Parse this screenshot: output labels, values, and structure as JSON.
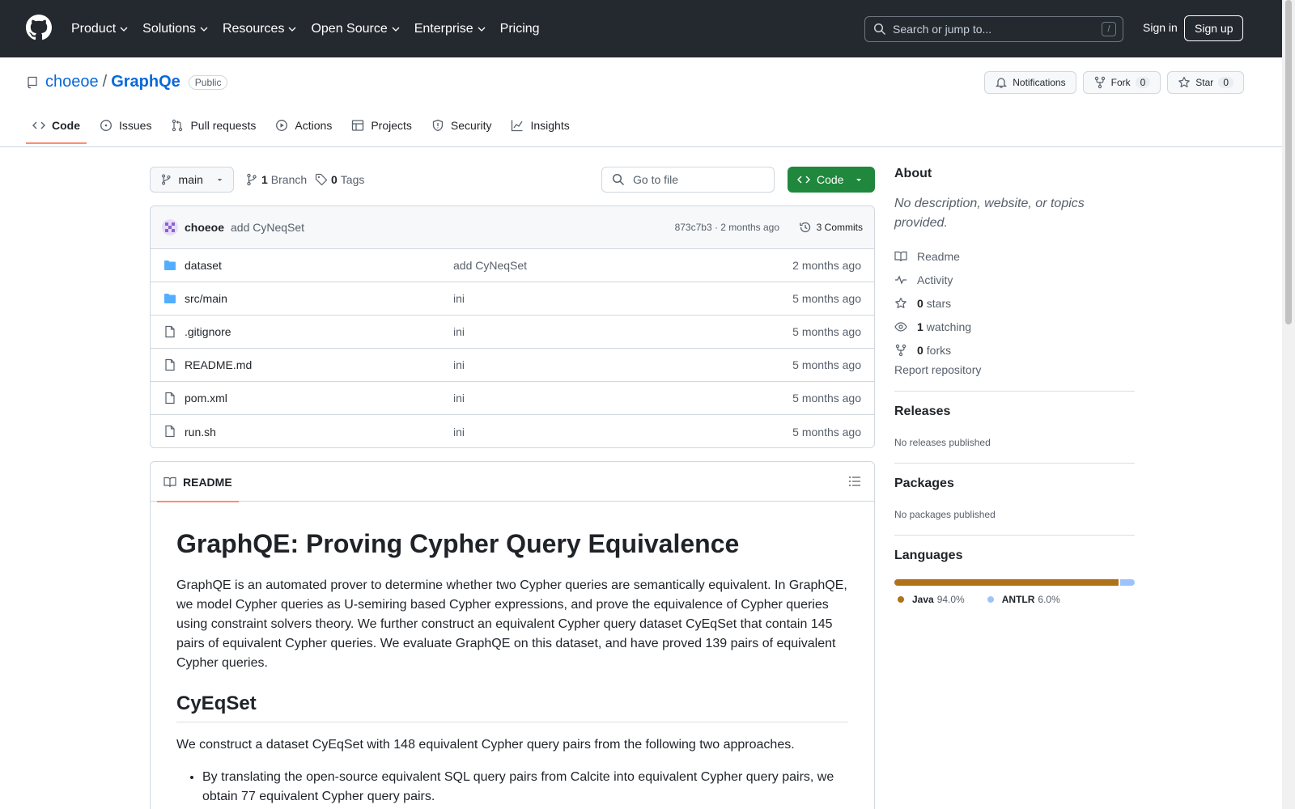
{
  "header": {
    "nav": [
      "Product",
      "Solutions",
      "Resources",
      "Open Source",
      "Enterprise",
      "Pricing"
    ],
    "search_placeholder": "Search or jump to...",
    "search_shortcut": "/",
    "signin": "Sign in",
    "signup": "Sign up"
  },
  "repo": {
    "owner": "choeoe",
    "separator": "/",
    "name": "GraphQe",
    "visibility": "Public",
    "notifications_label": "Notifications",
    "fork_label": "Fork",
    "fork_count": "0",
    "star_label": "Star",
    "star_count": "0",
    "tabs": [
      "Code",
      "Issues",
      "Pull requests",
      "Actions",
      "Projects",
      "Security",
      "Insights"
    ]
  },
  "branchbar": {
    "branch": "main",
    "branch_count": "1",
    "branch_label": "Branch",
    "tag_count": "0",
    "tag_label": "Tags",
    "goto_placeholder": "Go to file",
    "code_label": "Code"
  },
  "commit": {
    "author": "choeoe",
    "message": "add CyNeqSet",
    "meta": "873c7b3 · 2 months ago",
    "count_label": "3 Commits"
  },
  "files": [
    {
      "type": "folder",
      "name": "dataset",
      "message": "add CyNeqSet",
      "time": "2 months ago"
    },
    {
      "type": "folder",
      "name": "src/main",
      "message": "ini",
      "time": "5 months ago"
    },
    {
      "type": "file",
      "name": ".gitignore",
      "message": "ini",
      "time": "5 months ago"
    },
    {
      "type": "file",
      "name": "README.md",
      "message": "ini",
      "time": "5 months ago"
    },
    {
      "type": "file",
      "name": "pom.xml",
      "message": "ini",
      "time": "5 months ago"
    },
    {
      "type": "file",
      "name": "run.sh",
      "message": "ini",
      "time": "5 months ago"
    }
  ],
  "readme": {
    "tab_label": "README",
    "h1": "GraphQE: Proving Cypher Query Equivalence",
    "p1": "GraphQE is an automated prover to determine whether two Cypher queries are semantically equivalent. In GraphQE, we model Cypher queries as U-semiring based Cypher expressions, and prove the equivalence of Cypher queries using constraint solvers theory. We further construct an equivalent Cypher query dataset CyEqSet that contain 145 pairs of equivalent Cypher queries. We evaluate GraphQE on this dataset, and have proved 139 pairs of equivalent Cypher queries.",
    "h2": "CyEqSet",
    "p2": "We construct a dataset CyEqSet with 148 equivalent Cypher query pairs from the following two approaches.",
    "li1": "By translating the open-source equivalent SQL query pairs from Calcite into equivalent Cypher query pairs, we obtain 77 equivalent Cypher query pairs."
  },
  "sidebar": {
    "about_title": "About",
    "description": "No description, website, or topics provided.",
    "readme": "Readme",
    "activity": "Activity",
    "stars_count": "0",
    "stars_label": "stars",
    "watching_count": "1",
    "watching_label": "watching",
    "forks_count": "0",
    "forks_label": "forks",
    "report": "Report repository",
    "releases_title": "Releases",
    "releases_text": "No releases published",
    "packages_title": "Packages",
    "packages_text": "No packages published",
    "languages_title": "Languages",
    "languages": [
      {
        "name": "Java",
        "percent": "94.0%",
        "value": 94.0,
        "color": "#b07219"
      },
      {
        "name": "ANTLR",
        "percent": "6.0%",
        "value": 6.0,
        "color": "#9dc3ff"
      }
    ]
  }
}
